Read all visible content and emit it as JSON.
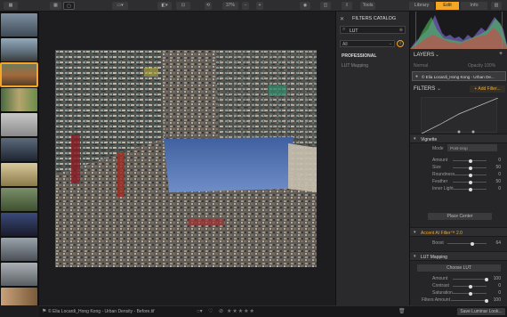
{
  "toolbar": {
    "zoom": "37%",
    "zoom_minus": "−",
    "zoom_plus": "+",
    "tools_label": "Tools",
    "tabs": [
      "Library",
      "Edit",
      "Info"
    ]
  },
  "catalog": {
    "title": "FILTERS CATALOG",
    "search_value": "LUT",
    "dropdown_value": "All",
    "category": "PROFESSIONAL",
    "item": "LUT Mapping"
  },
  "layers": {
    "title": "LAYERS",
    "blend_mode": "Normal",
    "opacity_label": "Opacity 100%",
    "layer_name": "© Elia Locardi_Hong Kong - Urban De..."
  },
  "filters": {
    "title": "FILTERS",
    "add_label": "+ Add Filter...",
    "vignette": {
      "title": "Vignette",
      "mode_label": "Mode",
      "mode_value": "Post-crop",
      "sliders": [
        {
          "label": "Amount",
          "value": "0",
          "pos": 0.5
        },
        {
          "label": "Size",
          "value": "50",
          "pos": 0.5
        },
        {
          "label": "Roundness",
          "value": "0",
          "pos": 0.5
        },
        {
          "label": "Feather",
          "value": "50",
          "pos": 0.5
        },
        {
          "label": "Inner Light",
          "value": "0",
          "pos": 0.5
        }
      ],
      "place_center": "Place Center"
    },
    "accent": {
      "title": "Accent AI Filter™ 2.0",
      "boost_label": "Boost",
      "boost_value": "64",
      "boost_pos": 0.64
    },
    "lut": {
      "title": "LUT Mapping",
      "choose": "Choose LUT",
      "sliders": [
        {
          "label": "Amount",
          "value": "100",
          "pos": 1.0
        },
        {
          "label": "Contrast",
          "value": "0",
          "pos": 0.5
        },
        {
          "label": "Saturation",
          "value": "0",
          "pos": 0.5
        }
      ],
      "filter_amount_label": "Filters Amount",
      "filter_amount_value": "100",
      "filter_amount_pos": 1.0
    }
  },
  "bottom": {
    "filename": "© Elia Locardi_Hong Kong - Urban Density - Before.tif",
    "stars": "★★★★★",
    "save_look": "Save Luminar Look..."
  },
  "colors": {
    "accent": "#f5a623",
    "sky": "#4a6ca8"
  }
}
